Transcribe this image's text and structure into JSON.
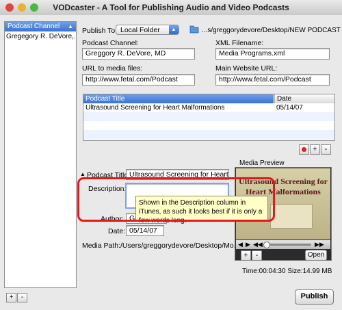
{
  "window": {
    "title": "VODcaster -  A Tool for Publishing Audio and Video Podcasts"
  },
  "sidebar": {
    "header": "Podcast Channel",
    "rows": [
      "Gregegory R. DeVore,..."
    ]
  },
  "publish_to": {
    "label": "Publish To:",
    "selected": "Local Folder",
    "path": "...s/greggorydevore/Desktop/NEW PODCAST"
  },
  "podcast_channel": {
    "label": "Podcast Channel:",
    "value": "Greggory R. DeVore, MD"
  },
  "xml_filename": {
    "label": "XML Filename:",
    "value": "Media Programs.xml"
  },
  "url_media": {
    "label": "URL to media files:",
    "value": "http://www.fetal.com/Podcast"
  },
  "main_site": {
    "label": "Main Website URL:",
    "value": "http://www.fetal.com/Podcast"
  },
  "table": {
    "columns": [
      "Podcast Title",
      "Date"
    ],
    "rows": [
      {
        "title": "Ultrasound Screening for Heart Malformations",
        "date": "05/14/07"
      }
    ]
  },
  "podcast_title": {
    "label": "Podcast Title:",
    "value": "Ultrasound Screening for Heart"
  },
  "description": {
    "label": "Description:",
    "value": ""
  },
  "tooltip": {
    "text": "Shown in the Description column in iTunes, as such it looks best if it is only a few words long."
  },
  "author": {
    "label": "Author:",
    "value": "Gregg"
  },
  "date": {
    "label": "Date:",
    "value": "05/14/07"
  },
  "media_path": {
    "label": "Media Path:",
    "value": "/Users/greggorydevore/Desktop/Mo..."
  },
  "media_preview": {
    "label": "Media Preview",
    "thumbnail_title": "Ultrasound Screening for Heart Malformations",
    "open_label": "Open",
    "info": "Time:00:04:30 Size:14.99 MB"
  },
  "buttons": {
    "publish": "Publish",
    "add": "+",
    "remove": "-"
  },
  "colors": {
    "accent": "#3a72d2",
    "highlight_box": "#e51919",
    "tooltip_bg": "#ffffc6"
  }
}
